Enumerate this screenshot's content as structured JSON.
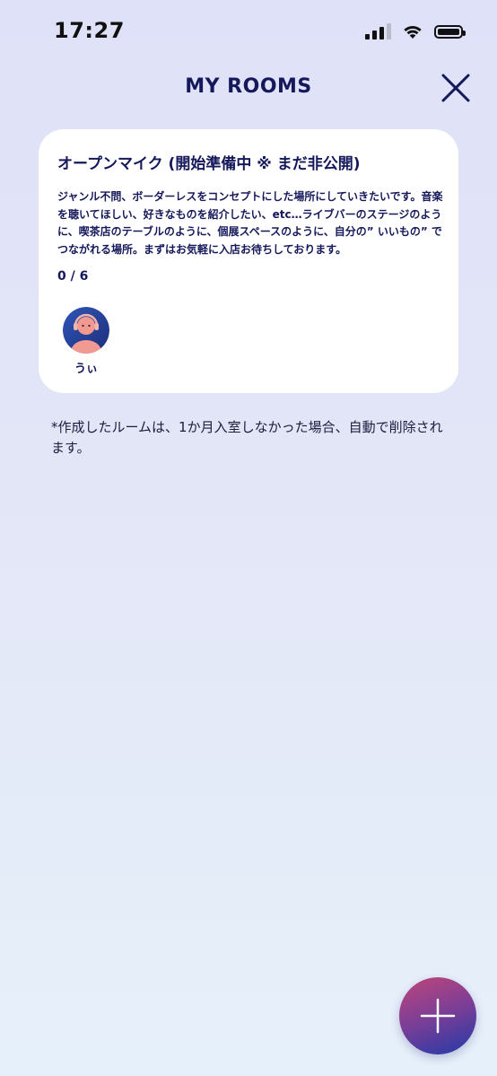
{
  "status_bar": {
    "time": "17:27"
  },
  "header": {
    "title": "MY ROOMS",
    "close_icon": "close-icon"
  },
  "room": {
    "title": "オープンマイク (開始準備中 ※ まだ非公開)",
    "description": "ジャンル不問、ボーダーレスをコンセプトにした場所にしていきたいです。音楽を聴いてほしい、好きなものを紹介したい、etc…ライブバーのステージのように、喫茶店のテーブルのように、個展スペースのように、自分の” いいもの” でつながれる場所。まずはお気軽に入店お待ちしております。",
    "capacity": "0 / 6",
    "members": [
      {
        "name": "うぃ",
        "avatar_icon": "user-avatar-headphones"
      }
    ]
  },
  "note": "*作成したルームは、1か月入室しなかった場合、自動で削除されます。",
  "fab": {
    "icon": "plus-icon"
  },
  "colors": {
    "primary_text": "#15185a",
    "background_top": "#dfe1f8",
    "background_bottom": "#e6f0fa",
    "card": "#ffffff",
    "fab_gradient_start": "#c0467a",
    "fab_gradient_end": "#223aa8"
  }
}
